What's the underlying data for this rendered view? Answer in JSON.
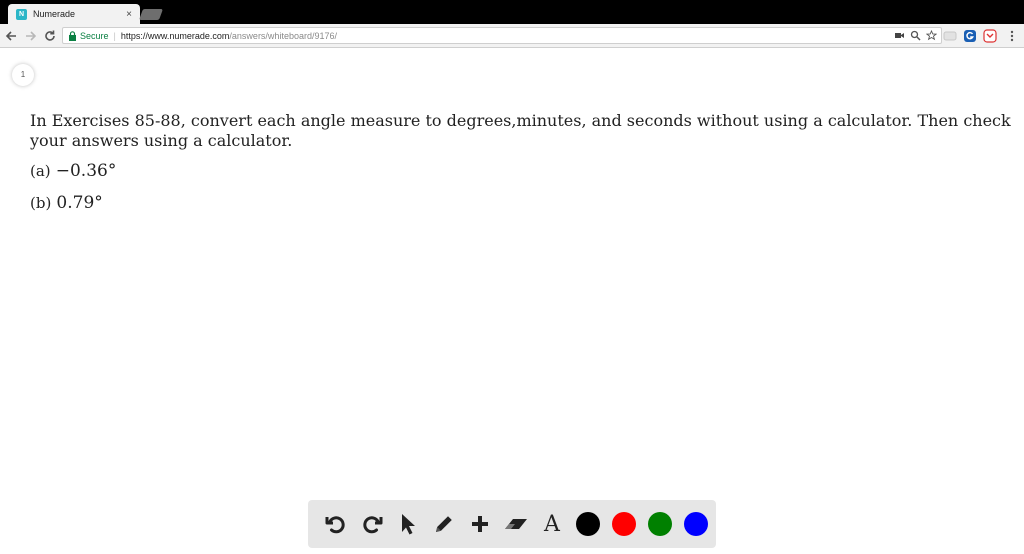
{
  "browser": {
    "tab_title": "Numerade",
    "favicon_text": "N",
    "close_symbol": "×",
    "secure_label": "Secure",
    "url_host": "https://www.numerade.com",
    "url_path": "/answers/whiteboard/9176/"
  },
  "page": {
    "page_number": "1",
    "question_text": "In Exercises 85-88, convert each angle measure to degrees,minutes, and seconds without using a calculator. Then check your answers using a calculator.",
    "parts": [
      {
        "label": "(a)",
        "value": "−0.36°"
      },
      {
        "label": "(b)",
        "value": "0.79°"
      }
    ]
  },
  "whiteboard": {
    "text_tool_glyph": "A",
    "colors": {
      "black": "#000000",
      "red": "#ff0000",
      "green": "#008000",
      "blue": "#0000ff"
    }
  }
}
